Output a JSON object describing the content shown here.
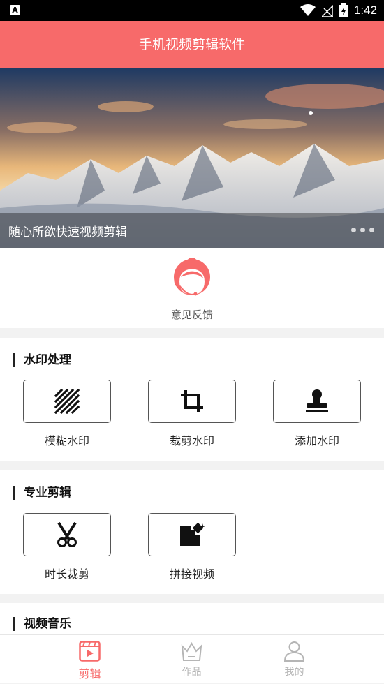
{
  "status_bar": {
    "time": "1:42"
  },
  "app_bar": {
    "title": "手机视频剪辑软件"
  },
  "banner": {
    "caption": "随心所欲快速视频剪辑"
  },
  "feedback": {
    "label": "意见反馈",
    "icon": "customer-service-icon"
  },
  "sections": [
    {
      "title": "水印处理",
      "tools": [
        {
          "label": "模糊水印",
          "icon": "blur-icon"
        },
        {
          "label": "裁剪水印",
          "icon": "crop-icon"
        },
        {
          "label": "添加水印",
          "icon": "stamp-icon"
        }
      ]
    },
    {
      "title": "专业剪辑",
      "tools": [
        {
          "label": "时长裁剪",
          "icon": "scissors-icon"
        },
        {
          "label": "拼接视频",
          "icon": "merge-icon"
        }
      ]
    },
    {
      "title": "视频音乐",
      "tools": []
    }
  ],
  "bottom_nav": [
    {
      "label": "剪辑",
      "icon": "video-play-icon",
      "active": true
    },
    {
      "label": "作品",
      "icon": "crown-icon",
      "active": false
    },
    {
      "label": "我的",
      "icon": "user-icon",
      "active": false
    }
  ],
  "colors": {
    "accent": "#f76a6a",
    "text": "#222222"
  }
}
